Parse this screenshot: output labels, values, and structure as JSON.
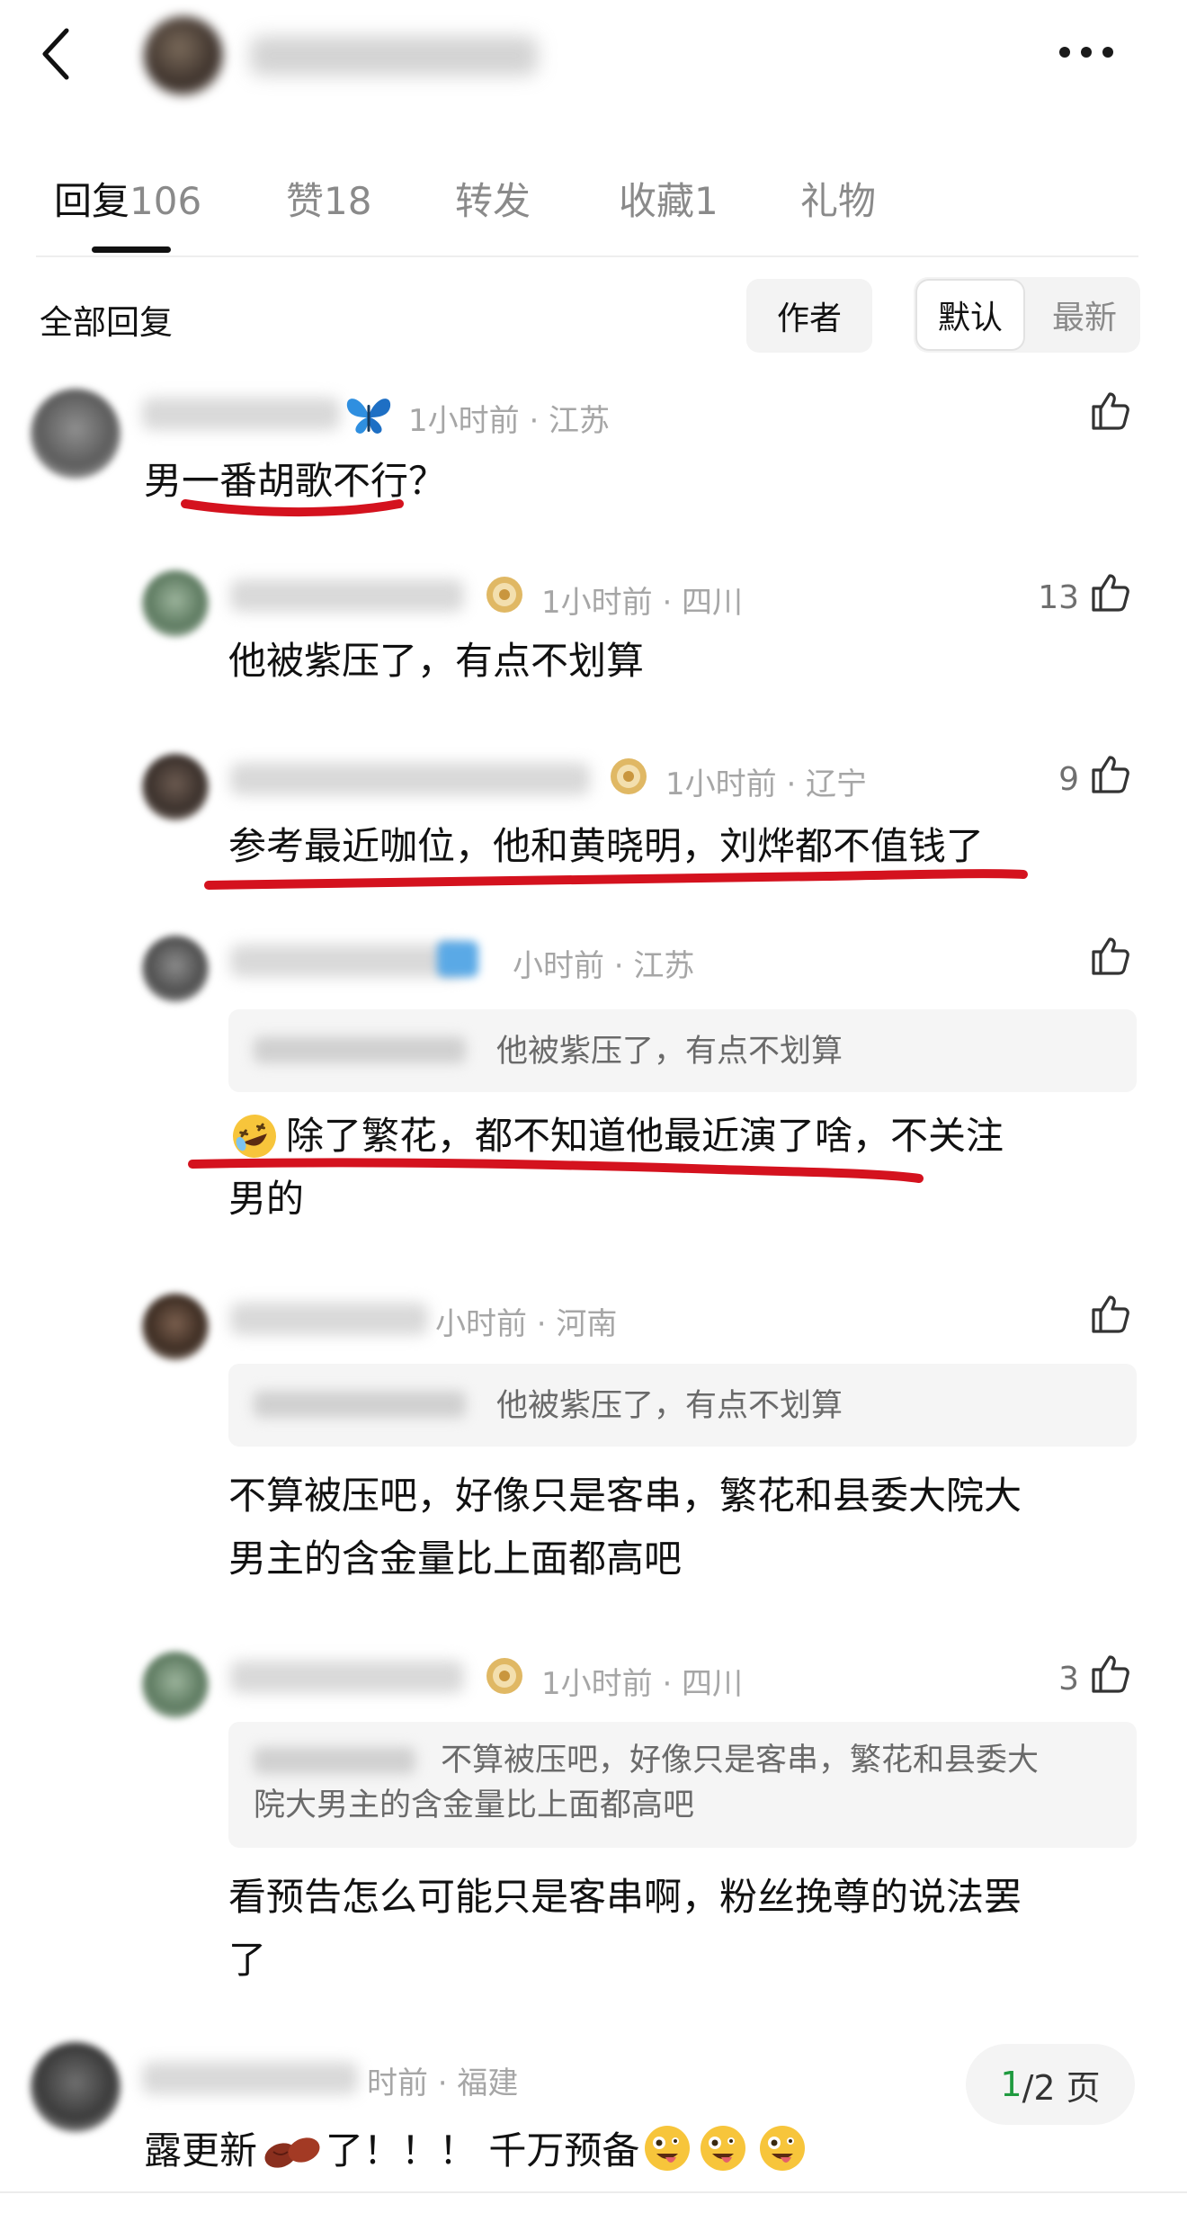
{
  "tabs": [
    {
      "label": "回复",
      "count": "106"
    },
    {
      "label": "赞",
      "count": "18"
    },
    {
      "label": "转发",
      "count": ""
    },
    {
      "label": "收藏",
      "count": "1"
    },
    {
      "label": "礼物",
      "count": ""
    }
  ],
  "filter": {
    "all_label": "全部回复",
    "author_label": "作者",
    "default_label": "默认",
    "latest_label": "最新"
  },
  "comments": [
    {
      "meta": "1小时前 · 江苏",
      "likes": "",
      "text": "男一番胡歌不行？"
    },
    {
      "meta": "1小时前 · 四川",
      "likes": "13",
      "text": "他被紫压了，有点不划算"
    },
    {
      "meta": "1小时前 · 辽宁",
      "likes": "9",
      "text": "参考最近咖位，他和黄晓明，刘烨都不值钱了"
    },
    {
      "meta": "小时前 · 江苏",
      "likes": "",
      "quote": "他被紫压了，有点不划算",
      "text_line1": "除了繁花，都不知道他最近演了啥，不关注",
      "text_line2": "男的"
    },
    {
      "meta": "小时前 · 河南",
      "likes": "",
      "quote": "他被紫压了，有点不划算",
      "text_line1": "不算被压吧，好像只是客串，繁花和县委大院大",
      "text_line2": "男主的含金量比上面都高吧"
    },
    {
      "meta": "1小时前 · 四川",
      "likes": "3",
      "quote_line1": "不算被压吧，好像只是客串，繁花和县委大",
      "quote_line2": "院大男主的含金量比上面都高吧",
      "text_line1": "看预告怎么可能只是客串啊，粉丝挽尊的说法罢",
      "text_line2": "了"
    },
    {
      "meta": "时前 · 福建",
      "likes": "",
      "text_a": "露更新",
      "text_b": "了！！！ 千万预备"
    }
  ],
  "pager": {
    "current": "1",
    "total": "/2 页"
  },
  "colors": {
    "underline_red": "#d4121e",
    "pager_current": "#1f9a3f"
  },
  "icons": [
    "back-icon",
    "more-icon",
    "thumb-up-icon",
    "butterfly-icon",
    "medal-icon",
    "laughing-emoji-icon",
    "bean-emoji-icon",
    "zany-face-emoji-icon"
  ]
}
